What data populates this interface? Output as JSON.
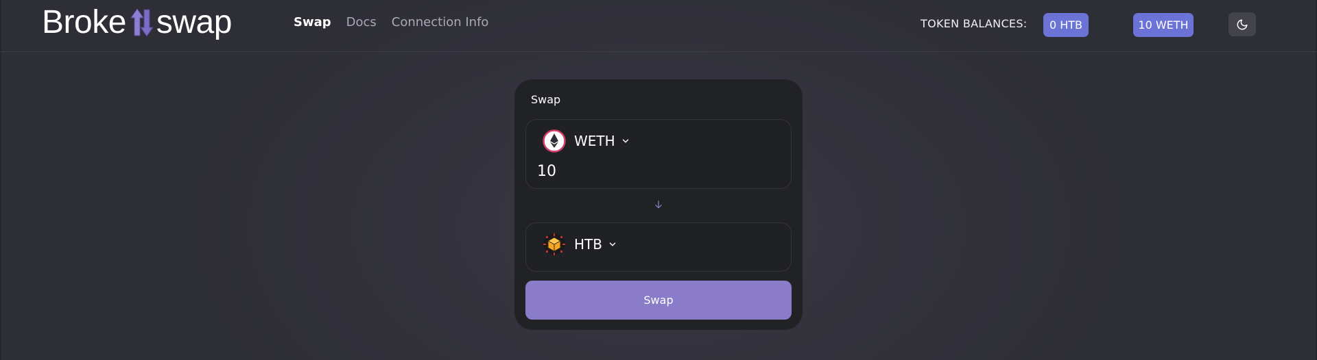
{
  "header": {
    "logo_left": "Broke",
    "logo_right": "swap",
    "nav": [
      {
        "label": "Swap",
        "active": true
      },
      {
        "label": "Docs",
        "active": false
      },
      {
        "label": "Connection Info",
        "active": false
      }
    ],
    "balances_label": "TOKEN BALANCES:",
    "balances": [
      {
        "label": "0 HTB"
      },
      {
        "label": "10 WETH"
      }
    ],
    "theme_icon": "moon-icon"
  },
  "card": {
    "title": "Swap",
    "from": {
      "token": "WETH",
      "icon": "ethereum-icon",
      "amount": "10"
    },
    "to": {
      "token": "HTB",
      "icon": "htb-cube-icon",
      "amount": ""
    },
    "arrow_icon": "arrow-down-icon",
    "button_label": "Swap"
  },
  "colors": {
    "accent_badge": "#6b74d6",
    "button": "#8a7cc9",
    "card_bg": "#212226",
    "page_bg": "#2e2e37"
  }
}
